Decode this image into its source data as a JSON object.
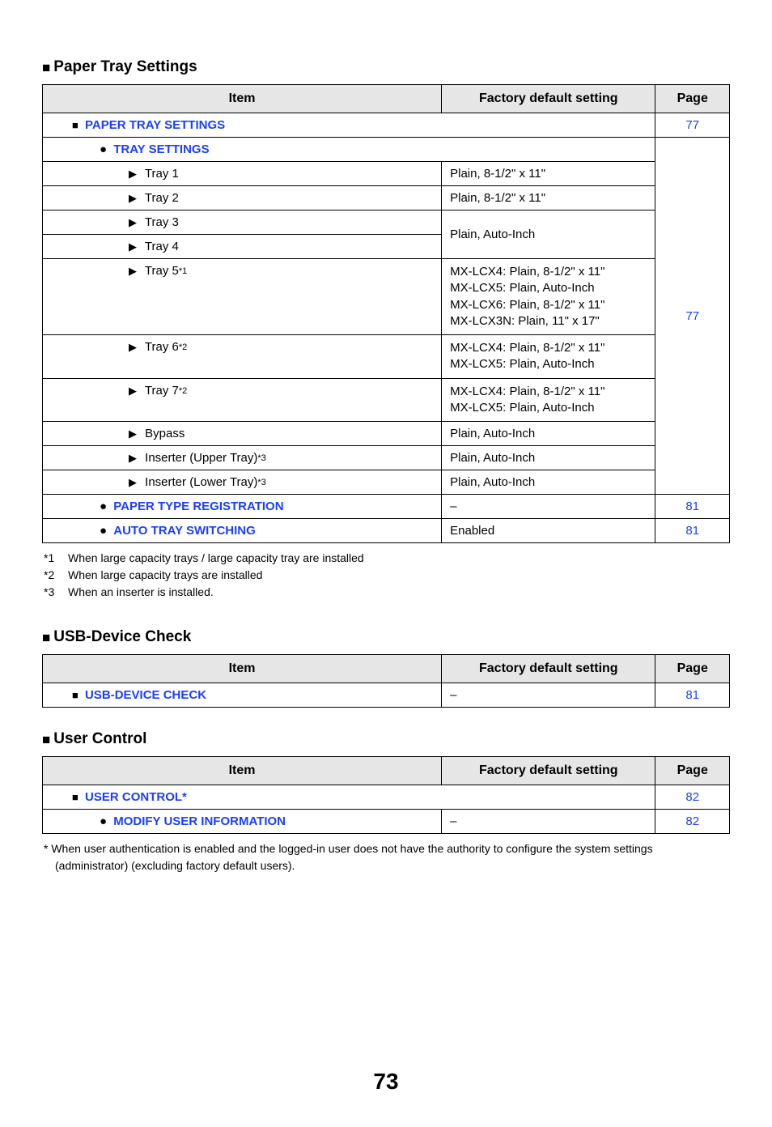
{
  "pageNumber": "73",
  "sections": {
    "paperTray": {
      "title": "Paper Tray Settings",
      "headers": {
        "item": "Item",
        "factory": "Factory default setting",
        "page": "Page"
      },
      "rows": {
        "pts": {
          "label": "PAPER TRAY SETTINGS",
          "page": "77"
        },
        "ts": {
          "label": "TRAY SETTINGS"
        },
        "tray1": {
          "label": "Tray 1",
          "factory": "Plain, 8-1/2\" x 11\""
        },
        "tray2": {
          "label": "Tray 2",
          "factory": "Plain, 8-1/2\" x 11\""
        },
        "tray3": {
          "label": "Tray 3"
        },
        "tray34f": {
          "factory": "Plain, Auto-Inch"
        },
        "tray4": {
          "label": "Tray 4"
        },
        "tray5": {
          "label": "Tray 5",
          "sup": "*1",
          "f1": "MX-LCX4: Plain, 8-1/2\" x 11\"",
          "f2": "MX-LCX5: Plain, Auto-Inch",
          "f3": "MX-LCX6: Plain, 8-1/2\" x 11\"",
          "f4": "MX-LCX3N: Plain, 11\" x 17\""
        },
        "tray6": {
          "label": "Tray 6",
          "sup": "*2",
          "f1": "MX-LCX4: Plain, 8-1/2\" x 11\"",
          "f2": "MX-LCX5: Plain, Auto-Inch"
        },
        "tray7": {
          "label": "Tray 7",
          "sup": "*2",
          "f1": "MX-LCX4: Plain, 8-1/2\" x 11\"",
          "f2": "MX-LCX5: Plain, Auto-Inch"
        },
        "bypass": {
          "label": "Bypass",
          "factory": "Plain, Auto-Inch"
        },
        "insU": {
          "label": "Inserter (Upper Tray)",
          "sup": "*3",
          "factory": "Plain, Auto-Inch"
        },
        "insL": {
          "label": "Inserter (Lower Tray)",
          "sup": "*3",
          "factory": "Plain, Auto-Inch"
        },
        "ptr": {
          "label": "PAPER TYPE REGISTRATION",
          "factory": "–",
          "page": "81"
        },
        "ats": {
          "label": "AUTO TRAY SWITCHING",
          "factory": "Enabled",
          "page": "81"
        },
        "tsPage": {
          "page": "77"
        }
      },
      "footnotes": {
        "f1k": "*1",
        "f1t": "When large capacity trays / large capacity tray are installed",
        "f2k": "*2",
        "f2t": "When large capacity trays are installed",
        "f3k": "*3",
        "f3t": "When an inserter is installed."
      }
    },
    "usb": {
      "title": "USB-Device Check",
      "headers": {
        "item": "Item",
        "factory": "Factory default setting",
        "page": "Page"
      },
      "rows": {
        "udc": {
          "label": "USB-DEVICE CHECK",
          "factory": "–",
          "page": "81"
        }
      }
    },
    "userControl": {
      "title": "User Control",
      "headers": {
        "item": "Item",
        "factory": "Factory default setting",
        "page": "Page"
      },
      "rows": {
        "uc": {
          "label": "USER CONTROL",
          "star": "*",
          "page": "82"
        },
        "mui": {
          "label": "MODIFY USER INFORMATION",
          "factory": "–",
          "page": "82"
        }
      },
      "noteStar": "*",
      "note1": "When user authentication is enabled and the logged-in user does not have the authority to configure the system settings",
      "note2": "(administrator) (excluding factory default users)."
    }
  }
}
